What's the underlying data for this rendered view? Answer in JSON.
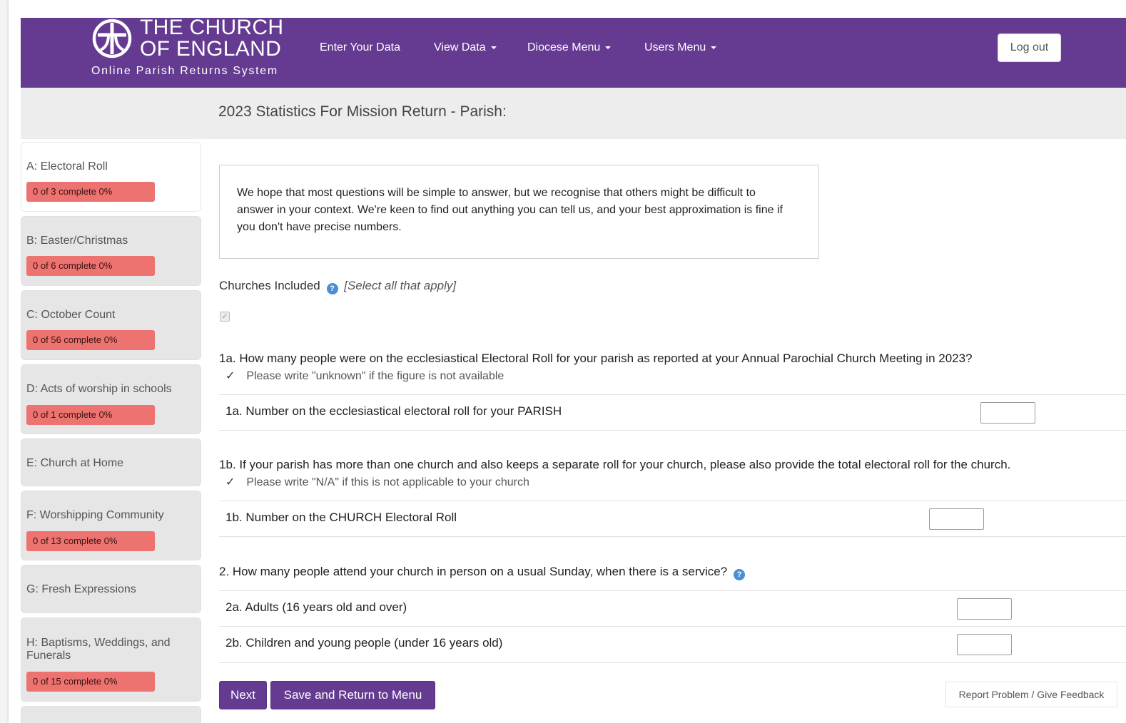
{
  "header": {
    "logo_line1": "THE CHURCH",
    "logo_line2": "OF ENGLAND",
    "logo_sub": "Online Parish Returns System",
    "nav": {
      "enter": "Enter Your Data",
      "view": "View Data",
      "diocese": "Diocese Menu",
      "users": "Users Menu"
    },
    "logout": "Log out",
    "brand_color": "#653a91"
  },
  "page": {
    "title": "2023 Statistics For Mission Return - Parish:"
  },
  "sidebar": {
    "items": [
      {
        "label": "A: Electoral Roll",
        "progress": "0 of 3 complete 0%",
        "active": true
      },
      {
        "label": "B: Easter/Christmas",
        "progress": "0 of 6 complete 0%"
      },
      {
        "label": "C: October Count",
        "progress": "0 of 56 complete 0%"
      },
      {
        "label": "D: Acts of worship in schools",
        "progress": "0 of 1 complete 0%"
      },
      {
        "label": "E: Church at Home"
      },
      {
        "label": "F: Worshipping Community",
        "progress": "0 of 13 complete 0%"
      },
      {
        "label": "G: Fresh Expressions"
      },
      {
        "label": "H: Baptisms, Weddings, and Funerals",
        "progress": "0 of 15 complete 0%"
      }
    ],
    "badge_color": "#ec7370"
  },
  "main": {
    "intro": "We hope that most questions will be simple to answer, but we recognise that others might be difficult to answer in your context. We're keen to find out anything you can tell us, and your best approximation is fine if you don't have precise numbers.",
    "churches_label": "Churches Included",
    "churches_hint": "[Select all that apply]",
    "q1a": "1a. How many people were on the ecclesiastical Electoral Roll for your parish as reported at your Annual Parochial Church Meeting in 2023?",
    "q1a_note": "Please write \"unknown\" if the figure is not available",
    "q1a_field": "1a. Number on the ecclesiastical electoral roll for your PARISH",
    "q1a_value": "",
    "q1b": "1b. If your parish has more than one church and also keeps a separate roll for your church, please also provide the total electoral roll for the church.",
    "q1b_note": "Please write \"N/A\" if this is not applicable to your church",
    "q1b_field": "1b. Number on the CHURCH Electoral Roll",
    "q1b_value": "",
    "q2": "2. How many people attend your church in person on a usual Sunday, when there is a service?",
    "q2a_field": "2a. Adults (16 years old and over)",
    "q2a_value": "",
    "q2b_field": "2b. Children and young people (under 16 years old)",
    "q2b_value": ""
  },
  "buttons": {
    "next": "Next",
    "save": "Save and Return to Menu",
    "report": "Report Problem / Give Feedback"
  }
}
